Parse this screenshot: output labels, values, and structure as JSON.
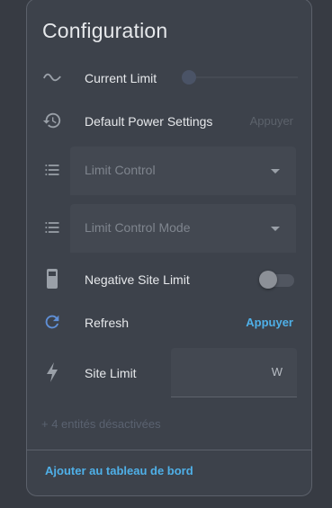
{
  "card": {
    "title": "Configuration"
  },
  "entities": [
    {
      "label": "Current Limit",
      "icon": "sine-wave-icon",
      "control": "slider",
      "value_fraction": 0
    },
    {
      "label": "Default Power Settings",
      "icon": "restore-icon",
      "action": "Appuyer",
      "action_state": "disabled"
    },
    {
      "label": "Limit Control",
      "icon": "list-icon",
      "control": "select",
      "selected": ""
    },
    {
      "label": "Limit Control Mode",
      "icon": "list-icon",
      "control": "select",
      "selected": ""
    },
    {
      "label": "Negative Site Limit",
      "icon": "phone-battery-icon",
      "control": "toggle",
      "state": "off"
    },
    {
      "label": "Refresh",
      "icon": "refresh-icon",
      "action": "Appuyer",
      "action_state": "active"
    },
    {
      "label": "Site Limit",
      "icon": "lightning-icon",
      "control": "number-input",
      "value": "",
      "unit": "W"
    }
  ],
  "disabled_note": "+ 4 entités désactivées",
  "footer": {
    "add_button": "Ajouter au tableau de bord"
  },
  "colors": {
    "background": "#373b43",
    "card": "#3d424b",
    "accent": "#4fb0e8",
    "icon_blue": "#5f8fd6",
    "icon_gray": "#9aa0a8"
  }
}
